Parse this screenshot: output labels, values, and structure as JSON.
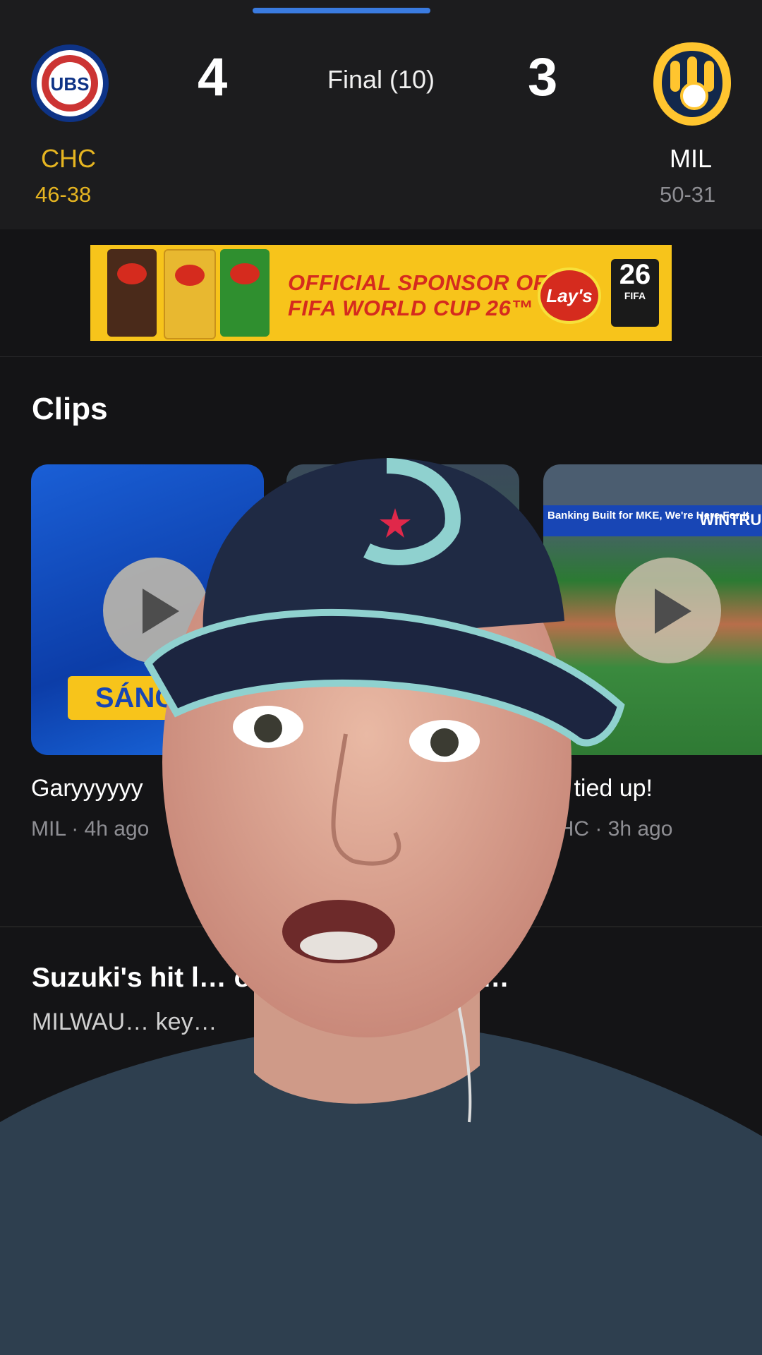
{
  "game": {
    "status": "Final (10)",
    "home": {
      "abbr": "CHC",
      "record": "46-38",
      "score": "4",
      "logo": "cubs-logo",
      "color": "#e6b521"
    },
    "away": {
      "abbr": "MIL",
      "record": "50-31",
      "score": "3",
      "logo": "brewers-logo",
      "color": "#ffffff"
    }
  },
  "ad": {
    "text_line1": "OFFICIAL SPONSOR OF",
    "text_line2": "FIFA WORLD CUP 26™",
    "brand": "Lay's",
    "badge": "26",
    "badge_sub": "FIFA"
  },
  "clips": {
    "title": "Clips",
    "items": [
      {
        "title": "Garyyyyyy",
        "meta": "MIL · 4h ago",
        "plate": "SÁNCH"
      },
      {
        "title": "",
        "meta": ""
      },
      {
        "title": "all tied up!",
        "meta": "CHC · 3h ago",
        "ad_strip": "Banking Built for MKE, We're Here For It",
        "ad_brand": "WINTRUS"
      }
    ]
  },
  "story": {
    "title_visible": "Suzuki's hit l… owers for series wi…",
    "body_visible": "MILWAU… key…"
  },
  "overlay": {
    "description_icon": "webcam-overlay"
  }
}
